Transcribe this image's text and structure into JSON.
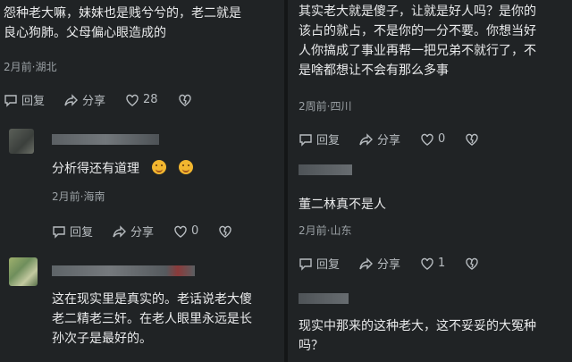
{
  "left": {
    "c1": {
      "text_line1": "怨种老大嘛，妹妹也是贱兮兮的，老二就是",
      "text_line2": "良心狗肺。父母偏心眼造成的",
      "meta": "2月前·湖北",
      "reply": "回复",
      "share": "分享",
      "likes": "28"
    },
    "c2": {
      "text": "分析得还有道理",
      "meta": "2月前·海南",
      "reply": "回复",
      "share": "分享",
      "likes": "0"
    },
    "c3": {
      "text_line1": "这在现实里是真实的。老话说老大傻",
      "text_line2": "老二精老三奸。在老人眼里永远是长",
      "text_line3": "孙次子是最好的。"
    }
  },
  "right": {
    "c1": {
      "text_line1": "其实老大就是傻子，让就是好人吗？是你的",
      "text_line2": "该占的就占，不是你的一分不要。你想当好",
      "text_line3": "人你搞成了事业再帮一把兄弟不就行了，不",
      "text_line4": "是啥都想让不会有那么多事",
      "meta": "2周前·四川",
      "reply": "回复",
      "share": "分享",
      "likes": "0"
    },
    "c2": {
      "text": "董二林真不是人",
      "meta": "2月前·山东",
      "reply": "回复",
      "share": "分享",
      "likes": "1"
    },
    "c3": {
      "text_line1": "现实中那来的这种老大，这不妥妥的大冤种",
      "text_line2": "吗？"
    }
  },
  "colors": {
    "background": "#202325",
    "text": "#e9eaeb",
    "meta": "#9aa0a4"
  },
  "icons": [
    "reply-icon",
    "share-icon",
    "heart-icon",
    "dislike-icon",
    "emoji-icon"
  ]
}
